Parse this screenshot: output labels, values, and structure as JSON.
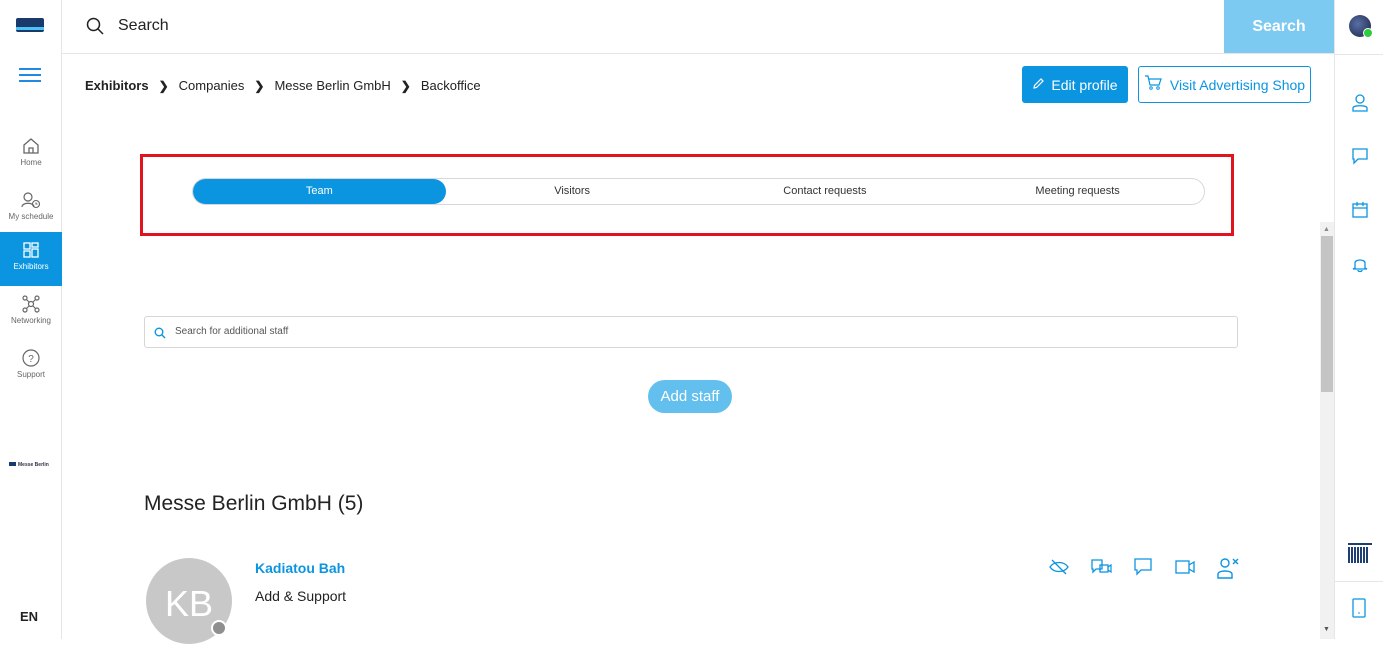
{
  "topbar": {
    "search_placeholder": "Search",
    "search_button": "Search"
  },
  "sidebar": {
    "items": [
      {
        "label": "Home",
        "icon": "home-icon"
      },
      {
        "label": "My schedule",
        "icon": "schedule-icon"
      },
      {
        "label": "Exhibitors",
        "icon": "exhibitors-icon",
        "active": true
      },
      {
        "label": "Networking",
        "icon": "networking-icon"
      },
      {
        "label": "Support",
        "icon": "support-icon"
      }
    ],
    "brand": "Messe Berlin",
    "language": "EN"
  },
  "breadcrumb": {
    "items": [
      "Exhibitors",
      "Companies",
      "Messe Berlin GmbH",
      "Backoffice"
    ]
  },
  "actions": {
    "edit_profile": "Edit profile",
    "visit_shop": "Visit Advertising Shop"
  },
  "tabs": [
    {
      "label": "Team",
      "active": true
    },
    {
      "label": "Visitors"
    },
    {
      "label": "Contact requests"
    },
    {
      "label": "Meeting requests"
    }
  ],
  "staff": {
    "search_placeholder": "Search for additional staff",
    "add_button": "Add staff"
  },
  "company": {
    "title": "Messe Berlin GmbH (5)"
  },
  "person": {
    "initials": "KB",
    "name": "Kadiatou Bah",
    "role": "Add & Support"
  },
  "colors": {
    "accent": "#0b95e0",
    "highlight_border": "#e0141c"
  }
}
